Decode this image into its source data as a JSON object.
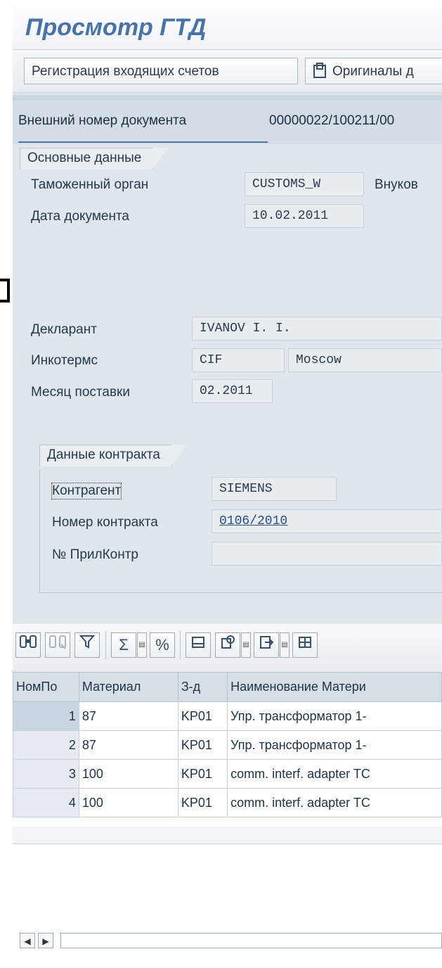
{
  "window": {
    "title": "Просмотр ГТД"
  },
  "toolbar": {
    "incoming_invoices_label": "Регистрация входящих счетов",
    "originals_label": "Оригиналы д"
  },
  "header": {
    "external_doc_number_label": "Внешний номер документа",
    "external_doc_number_value": "00000022/100211/00"
  },
  "basic_data": {
    "group_title": "Основные данные",
    "customs_label": "Таможенный орган",
    "customs_value": "CUSTOMS_W",
    "customs_name": "Внуков",
    "doc_date_label": "Дата документа",
    "doc_date_value": "10.02.2011",
    "declarant_label": "Декларант",
    "declarant_value": "IVANOV I. I.",
    "incoterms_label": "Инкотермс",
    "incoterms_code": "CIF",
    "incoterms_place": "Moscow",
    "delivery_month_label": "Месяц поставки",
    "delivery_month_value": "02.2011"
  },
  "contract_data": {
    "group_title": "Данные контракта",
    "counterparty_label": "Контрагент",
    "counterparty_value": "SIEMENS",
    "contract_number_label": "Номер контракта",
    "contract_number_value": "0106/2010",
    "appendix_label": "№ ПрилКонтр",
    "appendix_value": ""
  },
  "items_table": {
    "columns": [
      "НомПо",
      "Материал",
      "З-д",
      "Наименование Матери"
    ],
    "rows": [
      {
        "pos": "1",
        "material": "87",
        "plant": "KP01",
        "name": "Упр. трансформатор 1-"
      },
      {
        "pos": "2",
        "material": "87",
        "plant": "KP01",
        "name": "Упр. трансформатор 1-"
      },
      {
        "pos": "3",
        "material": "100",
        "plant": "KP01",
        "name": "comm. interf. adapter TC"
      },
      {
        "pos": "4",
        "material": "100",
        "plant": "KP01",
        "name": "comm. interf. adapter TC"
      }
    ]
  },
  "icons": {
    "toolbar_originals": "document-stamp-icon",
    "alv": [
      "find-icon",
      "find-next-icon",
      "filter-icon",
      "sum-icon",
      "subtotal-icon",
      "print-icon",
      "export-icon",
      "local-file-icon",
      "layout-icon"
    ]
  }
}
